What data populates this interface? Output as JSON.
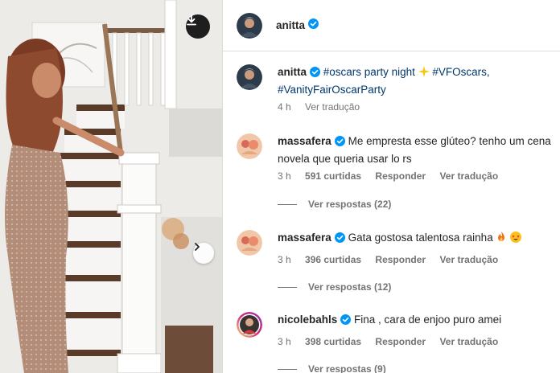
{
  "profile": {
    "username": "anitta"
  },
  "caption": {
    "username": "anitta",
    "text": "#oscars party night",
    "text_line2": "#VanityFairOscarParty",
    "tag_inline": "#VFOscars,",
    "time": "4 h",
    "translate": "Ver tradução"
  },
  "comments": [
    {
      "username": "massafera",
      "text": "Me empresta esse glúteo? tenho um cena",
      "text_line2": "novela que queria usar lo rs",
      "time": "3 h",
      "likes": "591 curtidas",
      "reply": "Responder",
      "translate": "Ver tradução",
      "view_replies": "Ver respostas (22)"
    },
    {
      "username": "massafera",
      "text": "Gata gostosa talentosa rainha",
      "time": "3 h",
      "likes": "396 curtidas",
      "reply": "Responder",
      "translate": "Ver tradução",
      "view_replies": "Ver respostas (12)"
    },
    {
      "username": "nicolebahls",
      "text": "Fina , cara de enjoo puro amei",
      "time": "3 h",
      "likes": "398 curtidas",
      "reply": "Responder",
      "translate": "Ver tradução",
      "view_replies": "Ver respostas (9)"
    }
  ],
  "icons": {
    "download": "download-icon",
    "next": "chevron-right-icon",
    "verified": "verified-badge-icon",
    "sparkle": "sparkle-emoji",
    "fire": "fire-emoji",
    "star_eyes": "star-struck-emoji"
  },
  "colors": {
    "verified": "#0095f6",
    "link": "#00376b",
    "muted": "#737373",
    "text": "#262626"
  }
}
